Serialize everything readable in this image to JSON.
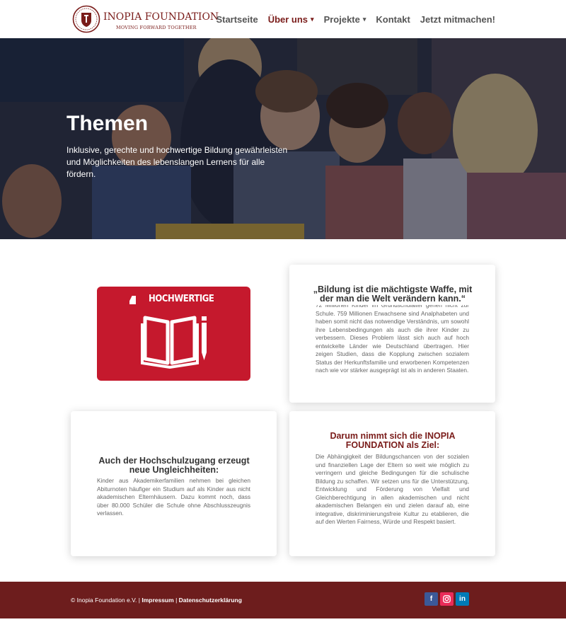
{
  "brand": {
    "name": "INOPIA FOUNDATION",
    "tagline": "MOVING FORWARD TOGETHER"
  },
  "nav": {
    "items": [
      {
        "label": "Startseite",
        "active": false,
        "dropdown": false
      },
      {
        "label": "Über uns",
        "active": true,
        "dropdown": true
      },
      {
        "label": "Projekte",
        "active": false,
        "dropdown": true
      },
      {
        "label": "Kontakt",
        "active": false,
        "dropdown": false
      },
      {
        "label": "Jetzt mitmachen!",
        "active": false,
        "dropdown": false
      }
    ]
  },
  "hero": {
    "title": "Themen",
    "subtitle": "Inklusive, gerechte und hochwertige Bildung gewährleisten und Möglichkeiten des lebenslangen Lernens für alle fördern."
  },
  "sdg": {
    "label": "HOCHWERTIGE"
  },
  "card_quote": {
    "heading": "„Bildung ist die mächtigste Waffe, mit der man die Welt verändern kann.“",
    "text": "72 Millionen Kinder im Grundschulalter gehen nicht zur Schule. 759 Millionen Erwachsene sind Analphabeten und haben somit nicht das notwendige Verständnis, um sowohl ihre Lebensbedingungen als auch die ihrer Kinder zu verbessern. Dieses Problem lässt sich auch auf hoch entwickelte Länder wie Deutschland übertragen. Hier zeigen Studien, dass die Kopplung zwischen sozialem Status der Herkunftsfamilie und erworbenen Kompetenzen nach wie vor stärker ausgeprägt ist als in anderen Staaten."
  },
  "card_uni": {
    "heading": "Auch der Hochschulzugang erzeugt neue Ungleichheiten:",
    "text": "Kinder aus Akademikerfamilien nehmen bei gleichen Abiturnoten häufiger ein Studium auf als Kinder aus nicht akademischen Elternhäusern. Dazu kommt noch, dass über 80.000 Schüler die Schule ohne Abschlusszeugnis verlassen."
  },
  "card_goal": {
    "heading": "Darum nimmt sich die INOPIA FOUNDATION als Ziel:",
    "text": "Die Abhängigkeit der Bildungschancen von der sozialen und finanziellen Lage der Eltern so weit wie möglich zu verringern und gleiche Bedingungen für die schulische Bildung zu schaffen. Wir setzen uns für die Unterstützung, Entwicklung und Förderung von Vielfalt und Gleichberechtigung in allen akademischen und nicht akademischen Belangen ein und zielen darauf ab, eine integrative, diskriminierungsfreie Kultur zu etablieren, die auf den Werten Fairness, Würde und Respekt basiert."
  },
  "footer": {
    "copyright": "© Inopia Foundation e.V. |",
    "impressum": "Impressum",
    "separator": "|",
    "privacy": "Datenschutzerklärung",
    "social": [
      {
        "name": "facebook-icon",
        "glyph": "f",
        "color": "#3b5998"
      },
      {
        "name": "instagram-icon",
        "glyph": "◎",
        "color": "#ea2c59"
      },
      {
        "name": "linkedin-icon",
        "glyph": "in",
        "color": "#007bb6"
      }
    ]
  },
  "colors": {
    "accent": "#7a1c1a",
    "footer_bg": "#6d1d1d",
    "sdg_red": "#c5192d"
  }
}
